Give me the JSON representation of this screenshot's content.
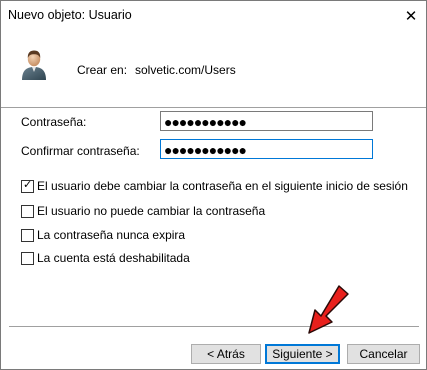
{
  "window": {
    "title": "Nuevo objeto: Usuario",
    "close_glyph": "✕"
  },
  "header": {
    "icon": "user-icon",
    "create_in_label": "Crear en:",
    "create_in_value": "solvetic.com/Users"
  },
  "form": {
    "password_label": "Contraseña:",
    "password_value": "●●●●●●●●●●●",
    "confirm_label": "Confirmar contraseña:",
    "confirm_value": "●●●●●●●●●●●"
  },
  "options": [
    {
      "label": "El usuario debe cambiar la contraseña en el siguiente inicio de sesión",
      "checked": true
    },
    {
      "label": "El usuario no puede cambiar la contraseña",
      "checked": false
    },
    {
      "label": "La contraseña nunca expira",
      "checked": false
    },
    {
      "label": "La cuenta está deshabilitada",
      "checked": false
    }
  ],
  "buttons": {
    "back": "< Atrás",
    "next": "Siguiente >",
    "cancel": "Cancelar"
  },
  "colors": {
    "focus_accent": "#0078d7",
    "arrow_red": "#e8201c"
  }
}
